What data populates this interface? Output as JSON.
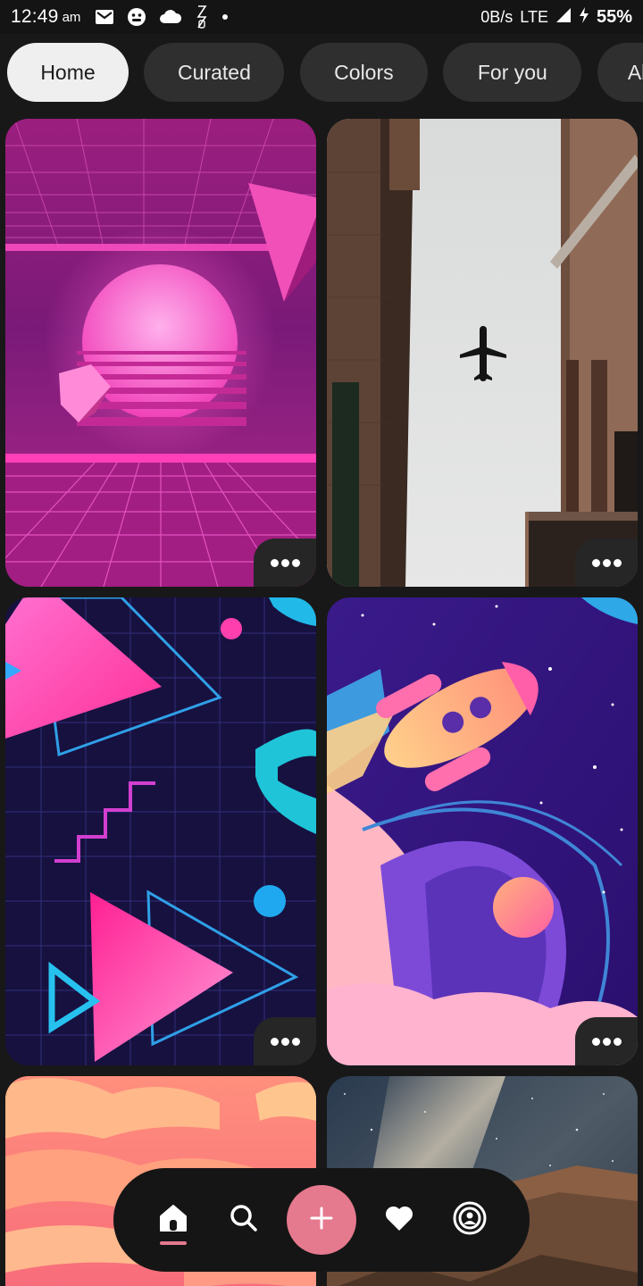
{
  "status_bar": {
    "time": "12:49",
    "ampm": "am",
    "net_speed": "0B/s",
    "network": "LTE",
    "battery": "55%"
  },
  "chips": [
    {
      "label": "Home",
      "active": true
    },
    {
      "label": "Curated",
      "active": false
    },
    {
      "label": "Colors",
      "active": false
    },
    {
      "label": "For you",
      "active": false
    },
    {
      "label": "Ab",
      "active": false
    }
  ],
  "grid": {
    "cards": [
      {
        "name": "synthwave-sun-wallpaper"
      },
      {
        "name": "airplane-between-buildings-wallpaper"
      },
      {
        "name": "retro-triangles-wallpaper"
      },
      {
        "name": "space-rocket-wallpaper"
      },
      {
        "name": "sunset-clouds-wallpaper"
      },
      {
        "name": "milky-way-cliff-wallpaper"
      }
    ],
    "more_icon": "more-horizontal-icon"
  },
  "bottom_nav": {
    "items": [
      "home-icon",
      "search-icon",
      "add-icon",
      "heart-icon",
      "profile-icon"
    ],
    "accent": "#e5798e"
  }
}
